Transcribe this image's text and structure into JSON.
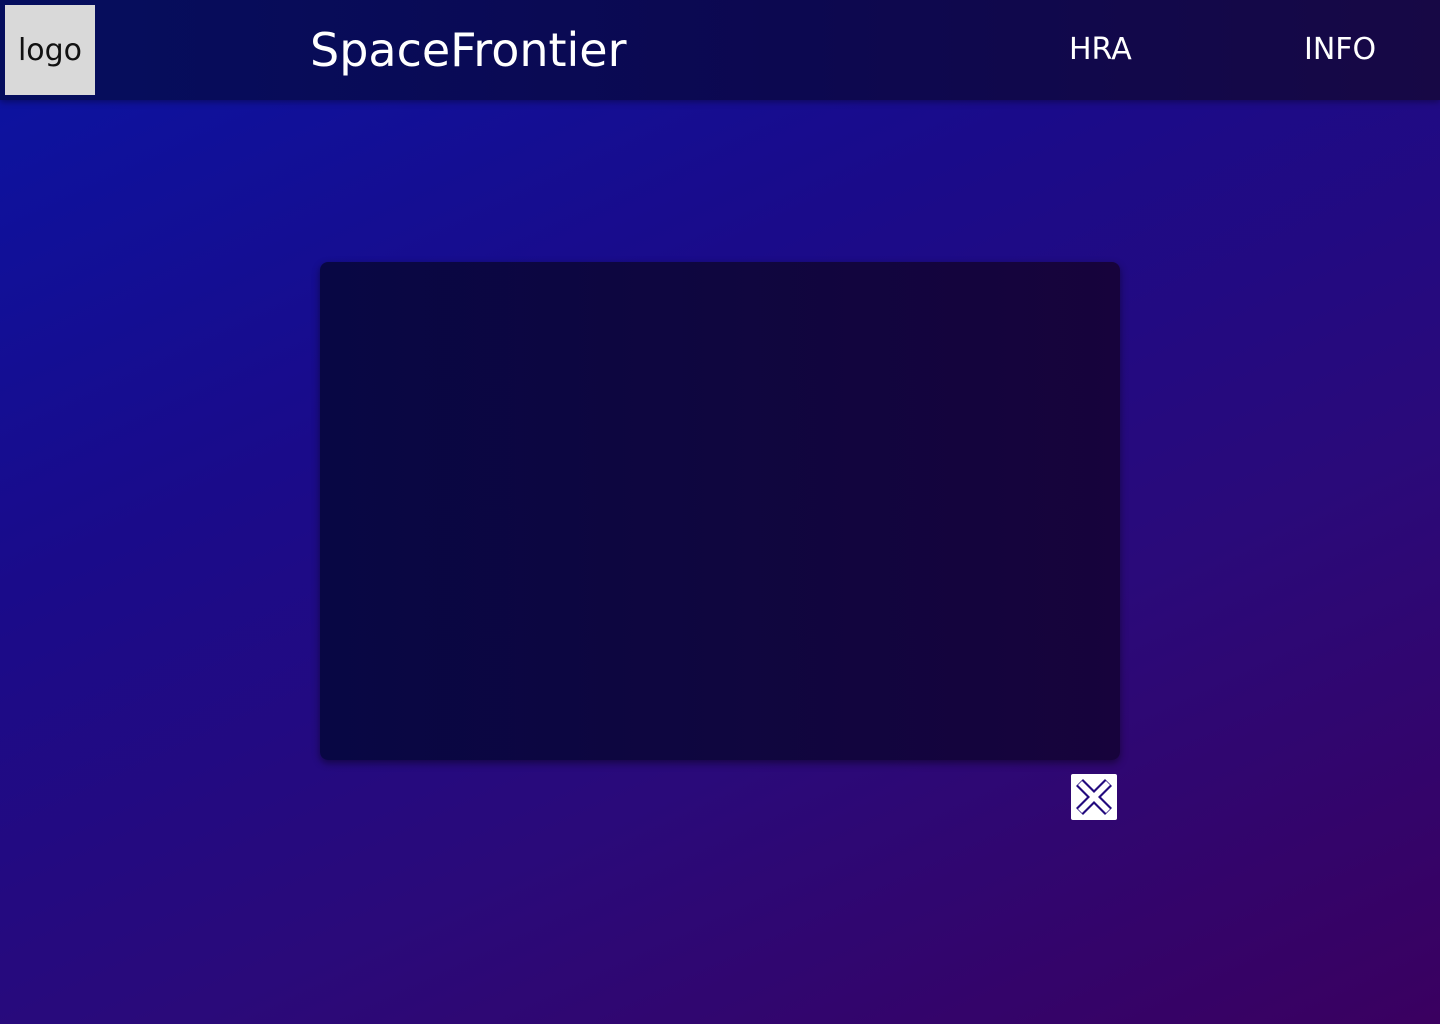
{
  "header": {
    "logo_label": "logo",
    "app_title": "SpaceFrontier",
    "nav": [
      {
        "label": "HRA"
      },
      {
        "label": "INFO"
      }
    ]
  },
  "viewer": {
    "expand_icon": "expand-arrows-icon"
  },
  "colors": {
    "background_start": "#0a14a3",
    "background_end": "#3a0060",
    "header_bg": "#050e5e",
    "viewer_bg": "#0c0640",
    "logo_bg": "#d9d9d9",
    "text": "#ffffff"
  }
}
